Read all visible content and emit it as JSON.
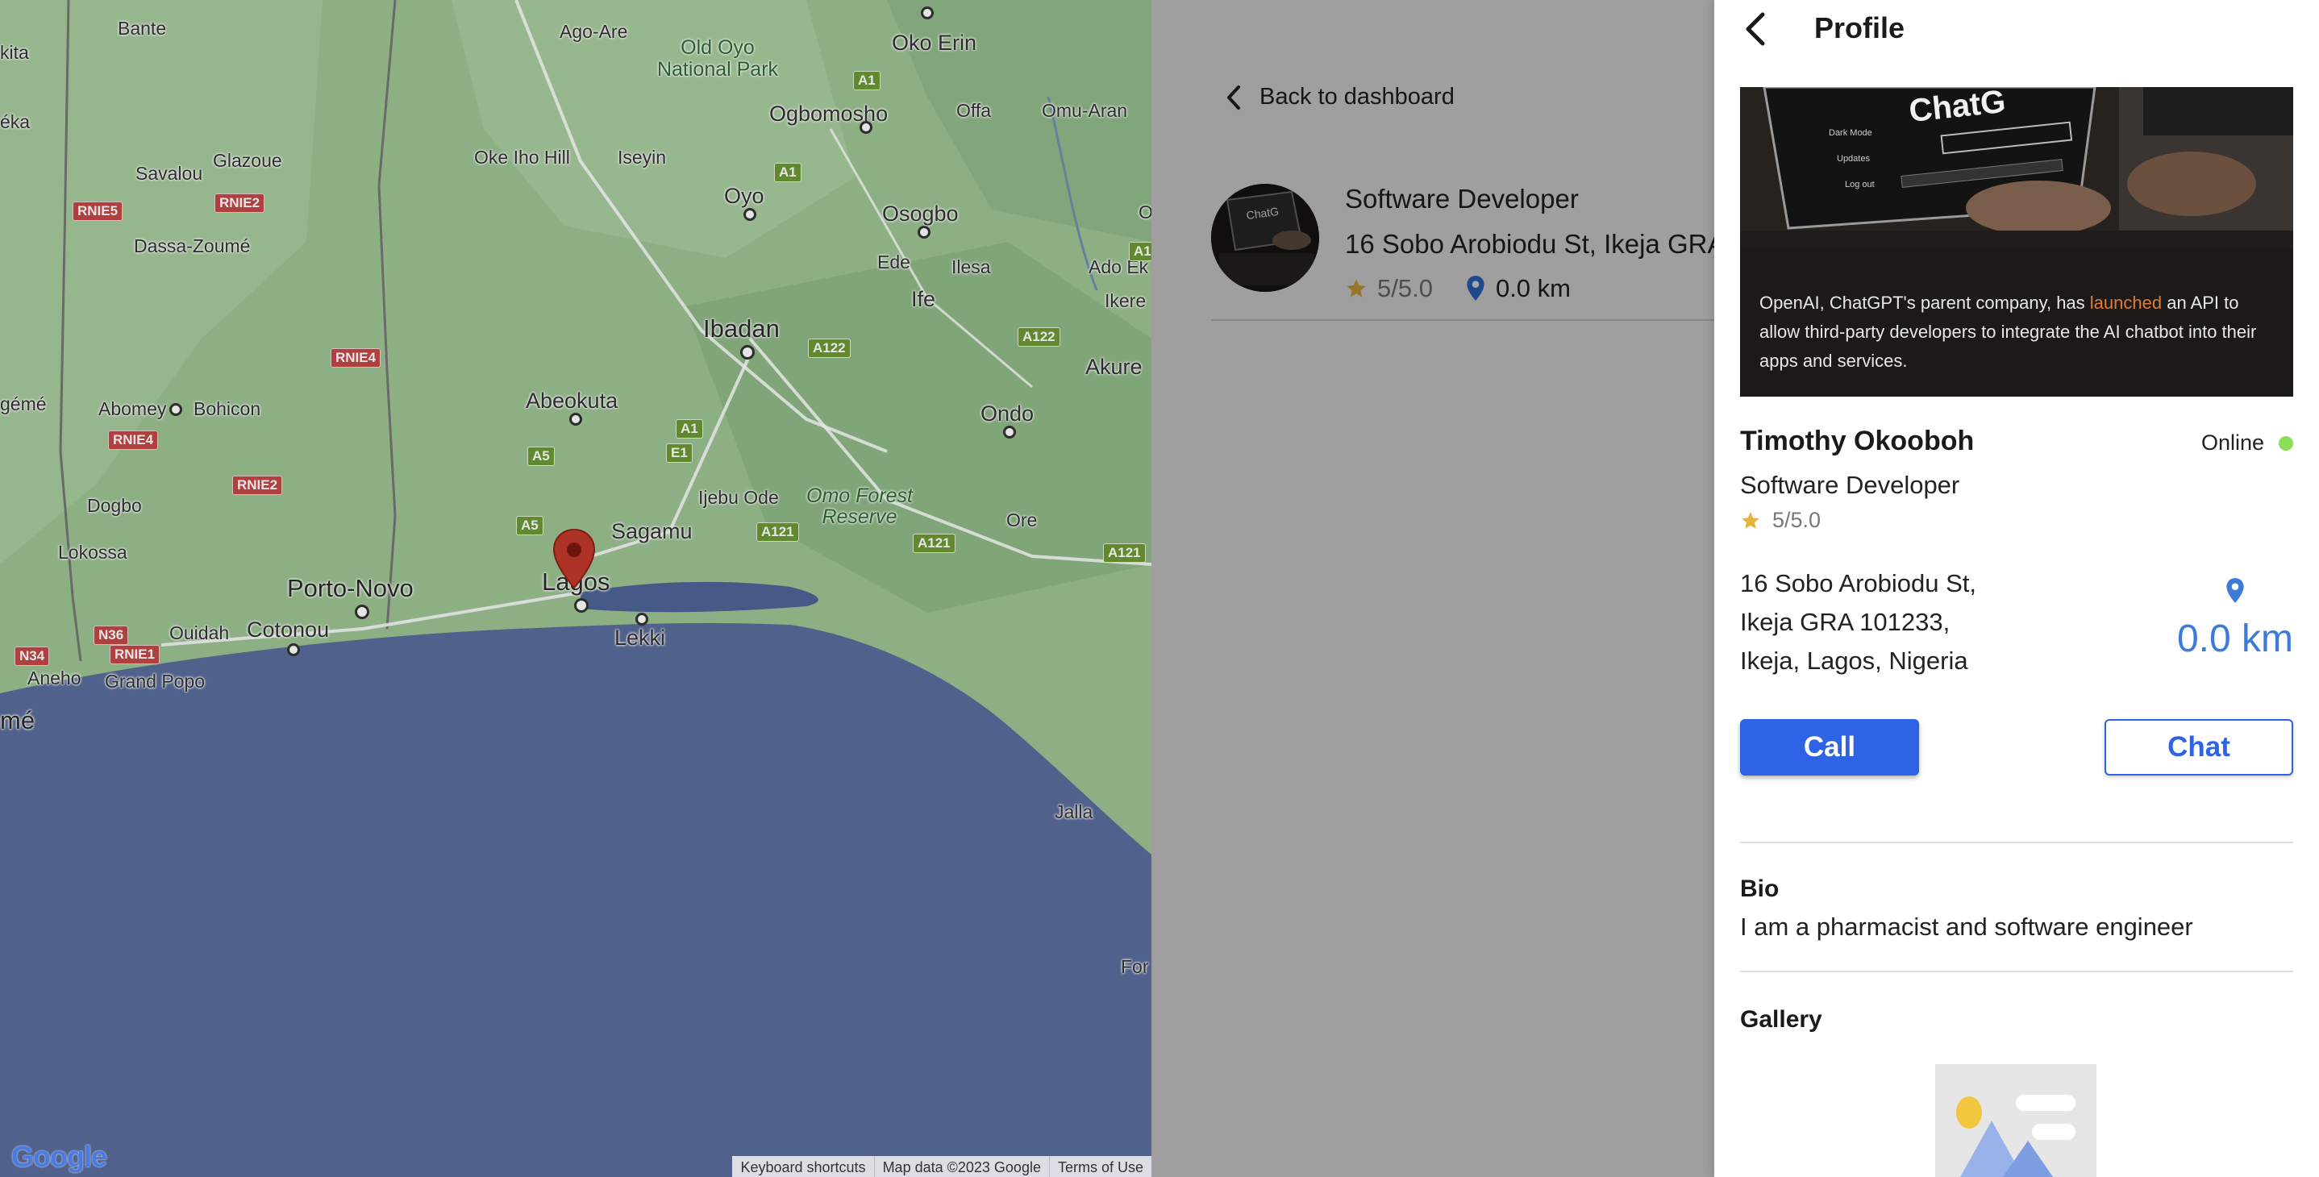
{
  "map": {
    "places": [
      {
        "name": "Bante"
      },
      {
        "name": "Ago-Are"
      },
      {
        "name": "Oko Erin"
      },
      {
        "name": "Old Oyo\nNational Park"
      },
      {
        "name": "Ogbomosho"
      },
      {
        "name": "Offa"
      },
      {
        "name": "Omu-Aran"
      },
      {
        "name": "Glazoue"
      },
      {
        "name": "Savalou"
      },
      {
        "name": "Oke Iho Hill"
      },
      {
        "name": "Iseyin"
      },
      {
        "name": "Oyo"
      },
      {
        "name": "Osogbo"
      },
      {
        "name": "Dassa-Zoumé"
      },
      {
        "name": "Ede"
      },
      {
        "name": "Ilesa"
      },
      {
        "name": "Ado Ek"
      },
      {
        "name": "Ife"
      },
      {
        "name": "Ikere"
      },
      {
        "name": "Ibadan"
      },
      {
        "name": "Akure"
      },
      {
        "name": "Abomey"
      },
      {
        "name": "Bohicon"
      },
      {
        "name": "Abeokuta"
      },
      {
        "name": "Ondo"
      },
      {
        "name": "Dogbo"
      },
      {
        "name": "Ijebu Ode"
      },
      {
        "name": "Omo Forest\nReserve"
      },
      {
        "name": "Sagamu"
      },
      {
        "name": "Ore"
      },
      {
        "name": "Lokossa"
      },
      {
        "name": "Porto-Novo"
      },
      {
        "name": "Lagos"
      },
      {
        "name": "Ouidah"
      },
      {
        "name": "Cotonou"
      },
      {
        "name": "Lekki"
      },
      {
        "name": "Aneho"
      },
      {
        "name": "Grand Popo"
      },
      {
        "name": "Jalla"
      },
      {
        "name": "kita"
      },
      {
        "name": "éka"
      },
      {
        "name": "gémé"
      },
      {
        "name": "mé"
      },
      {
        "name": "For"
      },
      {
        "name": "O"
      }
    ],
    "roads": [
      "A1",
      "A1",
      "A1",
      "A1",
      "A122",
      "A122",
      "A5",
      "A5",
      "E1",
      "A121",
      "A121",
      "A121",
      "RNIE2",
      "RNIE5",
      "RNIE4",
      "RNIE4",
      "RNIE2",
      "N36",
      "N34",
      "RNIE1"
    ],
    "logo": "Google",
    "footer": {
      "shortcuts": "Keyboard shortcuts",
      "data": "Map data ©2023 Google",
      "terms": "Terms of Use"
    }
  },
  "list": {
    "back_label": "Back to dashboard",
    "result": {
      "title": "Software Developer",
      "address": "16 Sobo Arobiodu St, Ikeja GRA",
      "rating": "5/5.0",
      "distance": "0.0 km"
    }
  },
  "profile": {
    "title": "Profile",
    "cover_caption_before": "OpenAI, ChatGPT's parent company, has ",
    "cover_caption_link": "launched",
    "cover_caption_after": " an API to allow third-party developers to integrate the AI chatbot into their apps and services.",
    "cover_screen_text": "ChatG",
    "name": "Timothy Okooboh",
    "status": "Online",
    "role": "Software Developer",
    "rating": "5/5.0",
    "address_line1": "16 Sobo Arobiodu St,",
    "address_line2": "Ikeja GRA 101233,",
    "address_line3": "Ikeja, Lagos, Nigeria",
    "distance": "0.0 km",
    "call_label": "Call",
    "chat_label": "Chat",
    "bio_heading": "Bio",
    "bio_text": "I am a pharmacist and software engineer",
    "gallery_heading": "Gallery"
  },
  "colors": {
    "primary": "#2d63e4",
    "online": "#8adf57",
    "accent_link": "#e07b36",
    "star": "#e8b23a",
    "pin_blue": "#3d7bd9",
    "map_pin": "#c0392b"
  }
}
